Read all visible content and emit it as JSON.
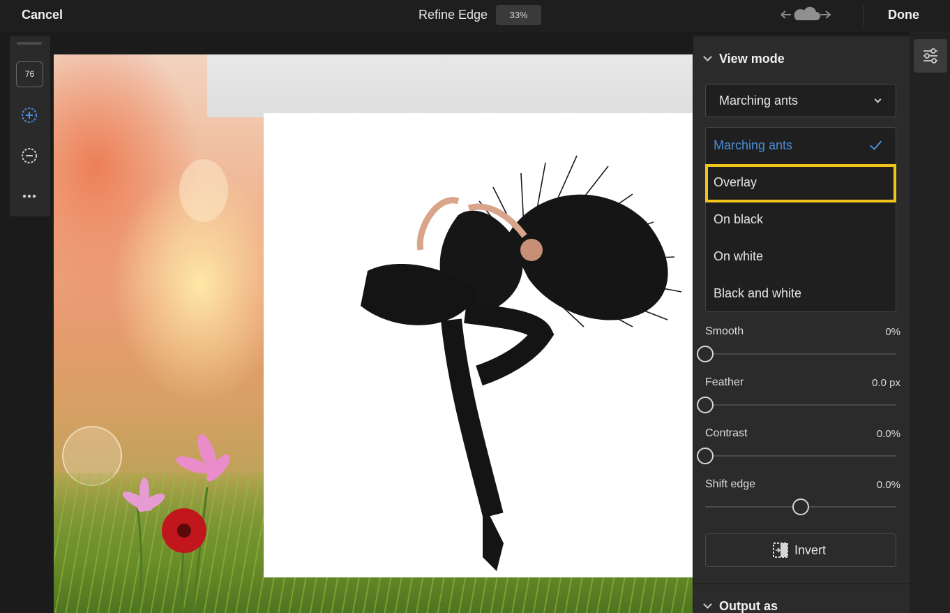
{
  "topbar": {
    "cancel_label": "Cancel",
    "title": "Refine Edge",
    "zoom": "33%",
    "done_label": "Done"
  },
  "toolrail": {
    "brush_size": "76",
    "icons": [
      "add-to-selection-icon",
      "subtract-from-selection-icon",
      "more-options-icon"
    ]
  },
  "panel": {
    "view_mode_heading": "View mode",
    "selected_view": "Marching ants",
    "view_options": [
      {
        "label": "Marching ants",
        "selected": true
      },
      {
        "label": "Overlay",
        "highlighted": true
      },
      {
        "label": "On black"
      },
      {
        "label": "On white"
      },
      {
        "label": "Black and white"
      }
    ],
    "sliders": [
      {
        "label": "Smooth",
        "value": "0%",
        "position": 0.0
      },
      {
        "label": "Feather",
        "value": "0.0 px",
        "position": 0.0
      },
      {
        "label": "Contrast",
        "value": "0.0%",
        "position": 0.0
      },
      {
        "label": "Shift edge",
        "value": "0.0%",
        "position": 0.5
      }
    ],
    "invert_label": "Invert",
    "output_heading": "Output as"
  },
  "colors": {
    "accent": "#4b8dd9",
    "highlight_outline": "#f0c419",
    "panel_bg": "#2b2b2b"
  }
}
